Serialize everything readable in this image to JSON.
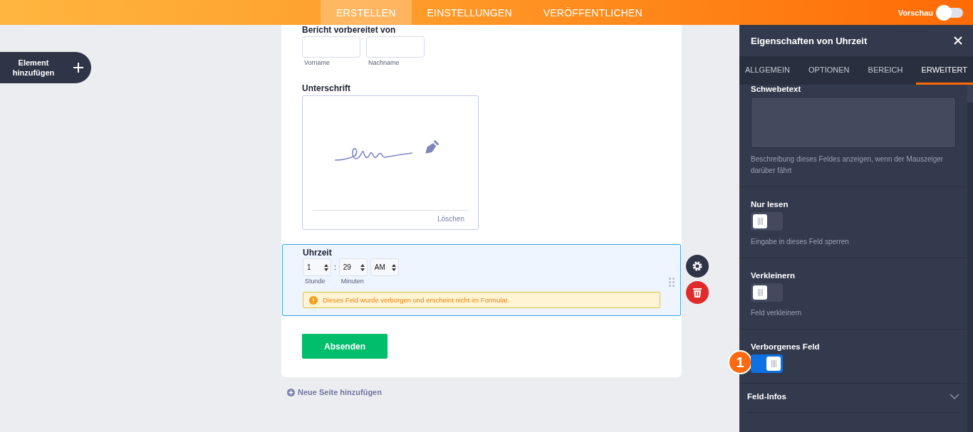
{
  "top_nav": {
    "tabs": [
      {
        "label": "ERSTELLEN",
        "selected": true
      },
      {
        "label": "EINSTELLUNGEN",
        "selected": false
      },
      {
        "label": "VERÖFFENTLICHEN",
        "selected": false
      }
    ],
    "preview": {
      "label": "Vorschau",
      "on": false
    }
  },
  "add_element": {
    "label": "Element hinzufügen"
  },
  "form": {
    "name_field": {
      "label": "Bericht vorbereitet von",
      "first": "Vorname",
      "last": "Nachname"
    },
    "signature": {
      "label": "Unterschrift",
      "clear": "Löschen"
    },
    "time": {
      "label": "Uhrzeit",
      "selected": true,
      "hour": "1",
      "minute": "29",
      "separator": ":",
      "ampm": "AM",
      "hour_label": "Stunde",
      "minute_label": "Minuten",
      "warning": "Dieses Feld wurde verborgen und erscheint nicht im Formular."
    },
    "submit": "Absenden",
    "add_page": "Neue Seite hinzufügen"
  },
  "panel": {
    "title": "Eigenschaften von Uhrzeit",
    "tabs": [
      {
        "label": "ALLGEMEIN",
        "selected": false
      },
      {
        "label": "OPTIONEN",
        "selected": false
      },
      {
        "label": "BEREICH",
        "selected": false
      },
      {
        "label": "ERWEITERT",
        "selected": true
      }
    ],
    "hover_text": {
      "label": "Schwebetext",
      "help": "Beschreibung dieses Feldes anzeigen, wenn der Mauszeiger darüber fährt"
    },
    "toggles": [
      {
        "label": "Nur lesen",
        "on": false,
        "help": "Eingabe in dieses Feld sperren"
      },
      {
        "label": "Verkleinern",
        "on": false,
        "help": "Feld verkleinern"
      },
      {
        "label": "Verborgenes Feld",
        "on": true,
        "badge": "1"
      }
    ],
    "sections": [
      {
        "label": "Feld-Infos",
        "expanded": false
      }
    ]
  }
}
